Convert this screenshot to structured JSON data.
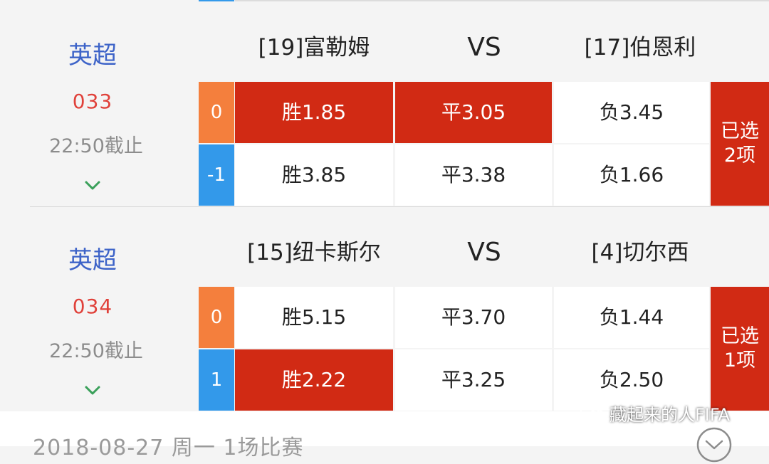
{
  "colors": {
    "accent_red": "#d12a14",
    "league_blue": "#3d63c8",
    "number_red": "#e0413a",
    "handicap_orange": "#f47f3d",
    "handicap_blue": "#3399ea"
  },
  "vs_label": "VS",
  "matches": [
    {
      "league": "英超",
      "number": "033",
      "deadline": "22:50截止",
      "home_team": "[19]富勒姆",
      "away_team": "[17]伯恩利",
      "rows": [
        {
          "handicap": "0",
          "handicap_color": "#f47f3d",
          "win": "胜1.85",
          "draw": "平3.05",
          "lose": "负3.45",
          "win_selected": true,
          "draw_selected": true,
          "lose_selected": false
        },
        {
          "handicap": "-1",
          "handicap_color": "#3399ea",
          "win": "胜3.85",
          "draw": "平3.38",
          "lose": "负1.66",
          "win_selected": false,
          "draw_selected": false,
          "lose_selected": false
        }
      ],
      "selected_line1": "已选",
      "selected_line2": "2项"
    },
    {
      "league": "英超",
      "number": "034",
      "deadline": "22:50截止",
      "home_team": "[15]纽卡斯尔",
      "away_team": "[4]切尔西",
      "rows": [
        {
          "handicap": "0",
          "handicap_color": "#f47f3d",
          "win": "胜5.15",
          "draw": "平3.70",
          "lose": "负1.44",
          "win_selected": false,
          "draw_selected": false,
          "lose_selected": false
        },
        {
          "handicap": "1",
          "handicap_color": "#3399ea",
          "win": "胜2.22",
          "draw": "平3.25",
          "lose": "负2.50",
          "win_selected": true,
          "draw_selected": false,
          "lose_selected": false
        }
      ],
      "selected_line1": "已选",
      "selected_line2": "1项"
    }
  ],
  "footer": {
    "text": "2018-08-27 周一    1场比赛",
    "icon": "chevron-down-circle-icon"
  },
  "watermark": {
    "text": "藏起来的人FIFA",
    "icon": "wechat-icon"
  }
}
